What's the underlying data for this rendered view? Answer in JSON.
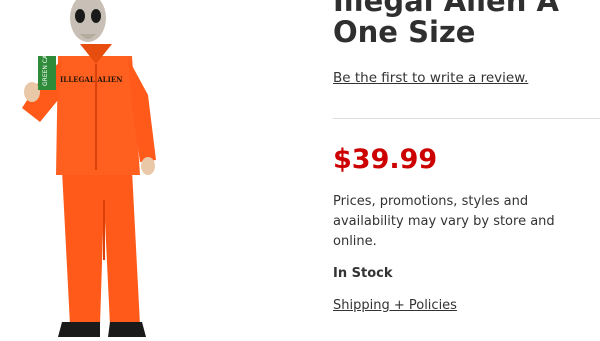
{
  "product": {
    "title_line1": "Illegal Alien A",
    "title_line2": "One Size",
    "review_link": "Be the first to write a review.",
    "price": "$39.99",
    "disclaimer": "Prices, promotions, styles and availability may vary by store and online.",
    "stock_status": "In Stock",
    "shipping_link": "Shipping + Policies",
    "image": {
      "jumpsuit_text": "ILLEGAL ALIEN",
      "card_text": "GREEN CARD"
    }
  },
  "colors": {
    "price": "#cc0000",
    "text": "#2f2f2f",
    "jumpsuit": "#ff5a1a"
  }
}
